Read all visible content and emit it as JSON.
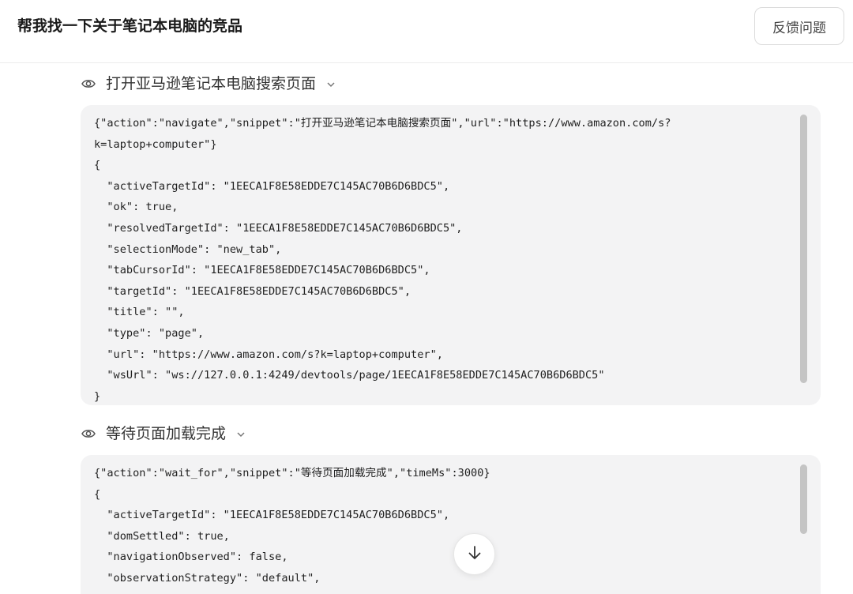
{
  "header": {
    "title": "帮我找一下关于笔记本电脑的竞品",
    "feedback_label": "反馈问题"
  },
  "steps": [
    {
      "title": "打开亚马逊笔记本电脑搜索页面",
      "expand_icon": "chevron-down-icon",
      "visibility_icon": "eye-icon",
      "code": "{\"action\":\"navigate\",\"snippet\":\"打开亚马逊笔记本电脑搜索页面\",\"url\":\"https://www.amazon.com/s?\nk=laptop+computer\"}\n{\n  \"activeTargetId\": \"1EECA1F8E58EDDE7C145AC70B6D6BDC5\",\n  \"ok\": true,\n  \"resolvedTargetId\": \"1EECA1F8E58EDDE7C145AC70B6D6BDC5\",\n  \"selectionMode\": \"new_tab\",\n  \"tabCursorId\": \"1EECA1F8E58EDDE7C145AC70B6D6BDC5\",\n  \"targetId\": \"1EECA1F8E58EDDE7C145AC70B6D6BDC5\",\n  \"title\": \"\",\n  \"type\": \"page\",\n  \"url\": \"https://www.amazon.com/s?k=laptop+computer\",\n  \"wsUrl\": \"ws://127.0.0.1:4249/devtools/page/1EECA1F8E58EDDE7C145AC70B6D6BDC5\"\n}"
    },
    {
      "title": "等待页面加载完成",
      "expand_icon": "chevron-down-icon",
      "visibility_icon": "eye-icon",
      "code": "{\"action\":\"wait_for\",\"snippet\":\"等待页面加载完成\",\"timeMs\":3000}\n{\n  \"activeTargetId\": \"1EECA1F8E58EDDE7C145AC70B6D6BDC5\",\n  \"domSettled\": true,\n  \"navigationObserved\": false,\n  \"observationStrategy\": \"default\","
    }
  ],
  "scroll_down_icon": "arrow-down-icon"
}
